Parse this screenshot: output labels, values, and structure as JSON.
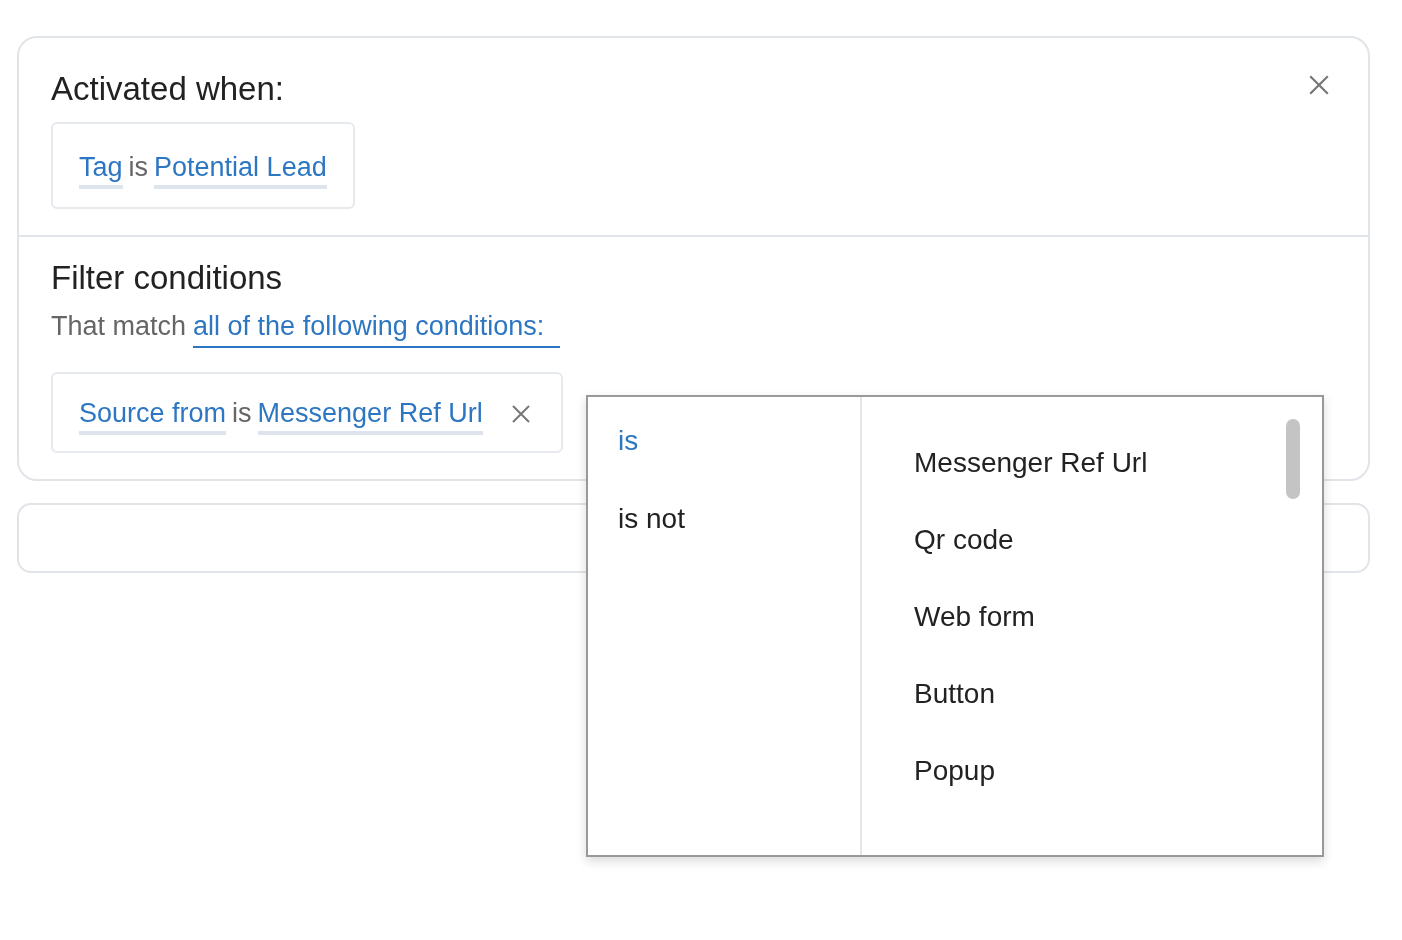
{
  "trigger": {
    "title": "Activated when:",
    "condition": {
      "field": "Tag",
      "operator": "is",
      "value": "Potential Lead"
    }
  },
  "filter": {
    "title": "Filter conditions",
    "match_prefix": "That match",
    "match_mode": "all of the following conditions:",
    "conditions": [
      {
        "field": "Source from",
        "operator": "is",
        "value": "Messenger Ref Url"
      }
    ]
  },
  "dropdown": {
    "operators": [
      {
        "label": "is",
        "selected": true
      },
      {
        "label": "is not",
        "selected": false
      }
    ],
    "options": [
      "Messenger Ref Url",
      "Qr code",
      "Web form",
      "Button",
      "Popup"
    ]
  }
}
